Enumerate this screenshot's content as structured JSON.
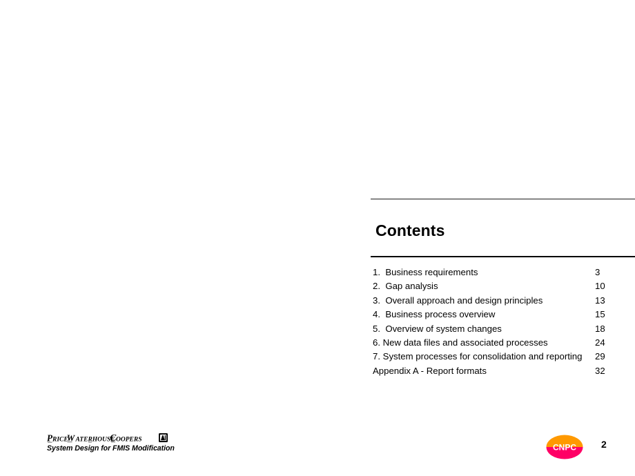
{
  "slide": {
    "background_color": "#ffffff",
    "page_number": "2"
  },
  "contents": {
    "title": "Contents",
    "items": [
      {
        "label": "1.  Business requirements",
        "page": "3"
      },
      {
        "label": "2.  Gap analysis",
        "page": "10"
      },
      {
        "label": "3.  Overall approach and design principles",
        "page": "13"
      },
      {
        "label": "4.  Business process overview",
        "page": "15"
      },
      {
        "label": "5.  Overview of system changes",
        "page": "18"
      },
      {
        "label": "6. New data files and associated processes",
        "page": "24"
      },
      {
        "label": "7. System processes for consolidation and reporting",
        "page": "29"
      },
      {
        "label": "Appendix A - Report formats",
        "page": "32"
      }
    ]
  },
  "footer": {
    "pwc": {
      "wordmark": "PRICEWATERHOUSECOOPERS",
      "mark_icon": "pwc-registered-mark-icon",
      "tagline": "System Design for FMIS Modification"
    },
    "cnpc": {
      "logo_text": "CNPC",
      "icon": "cnpc-oval-logo-icon",
      "color_top": "#FF9900",
      "color_bottom": "#FF0066",
      "text_color": "#ffffff"
    }
  }
}
